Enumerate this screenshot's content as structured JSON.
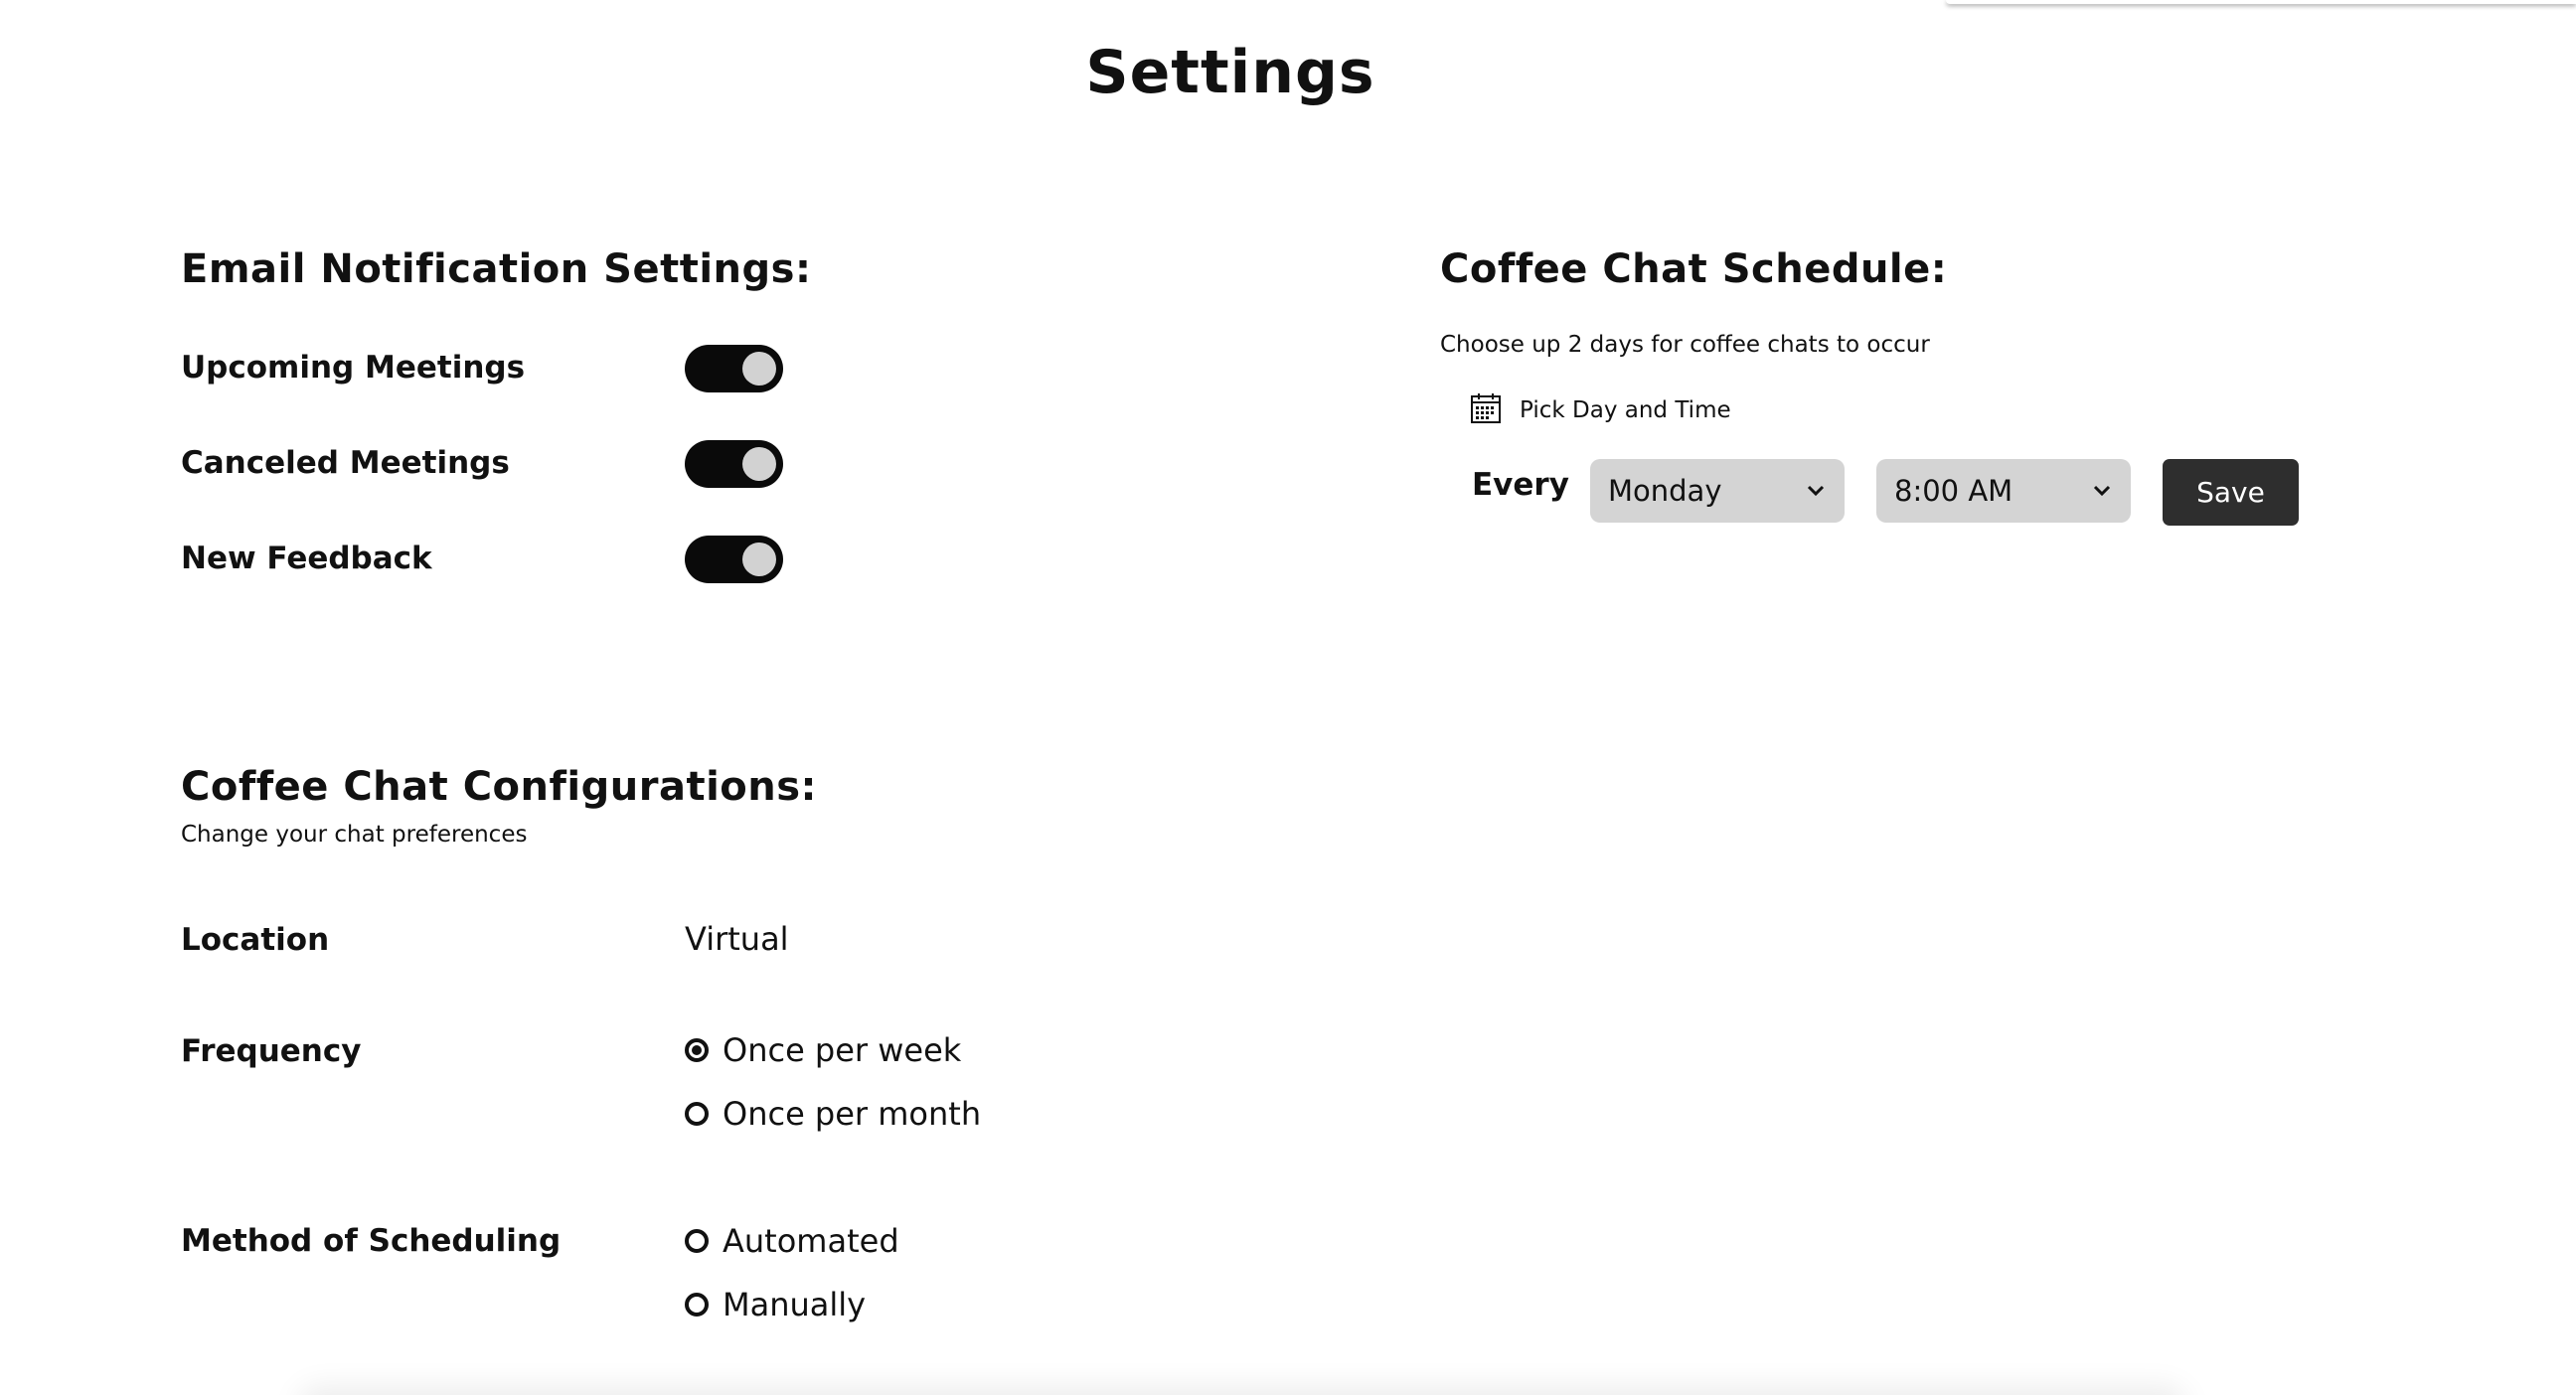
{
  "page": {
    "title": "Settings"
  },
  "email_notifications": {
    "heading": "Email Notification Settings:",
    "items": [
      {
        "label": "Upcoming Meetings",
        "enabled": true
      },
      {
        "label": "Canceled Meetings",
        "enabled": true
      },
      {
        "label": "New Feedback",
        "enabled": true
      }
    ]
  },
  "schedule": {
    "heading": "Coffee Chat Schedule:",
    "description": "Choose up 2 days for coffee chats to occur",
    "pick_label": "Pick Day and Time",
    "pick_icon": "calendar-icon",
    "every_label": "Every",
    "day_select": {
      "value": "Monday"
    },
    "time_select": {
      "value": "8:00 AM"
    },
    "save_label": "Save"
  },
  "configurations": {
    "heading": "Coffee Chat Configurations:",
    "subheading": "Change your chat preferences",
    "location": {
      "label": "Location",
      "value": "Virtual"
    },
    "frequency": {
      "label": "Frequency",
      "options": [
        {
          "label": "Once per week",
          "selected": true
        },
        {
          "label": "Once per month",
          "selected": false
        }
      ]
    },
    "method": {
      "label": "Method of Scheduling",
      "options": [
        {
          "label": "Automated",
          "selected": false
        },
        {
          "label": "Manually",
          "selected": false
        }
      ]
    }
  },
  "colors": {
    "toggle_on": "#0a0a0a",
    "toggle_knob": "#d2d2d2",
    "select_bg": "#d4d4d4",
    "button_bg": "#2e2e2e"
  }
}
